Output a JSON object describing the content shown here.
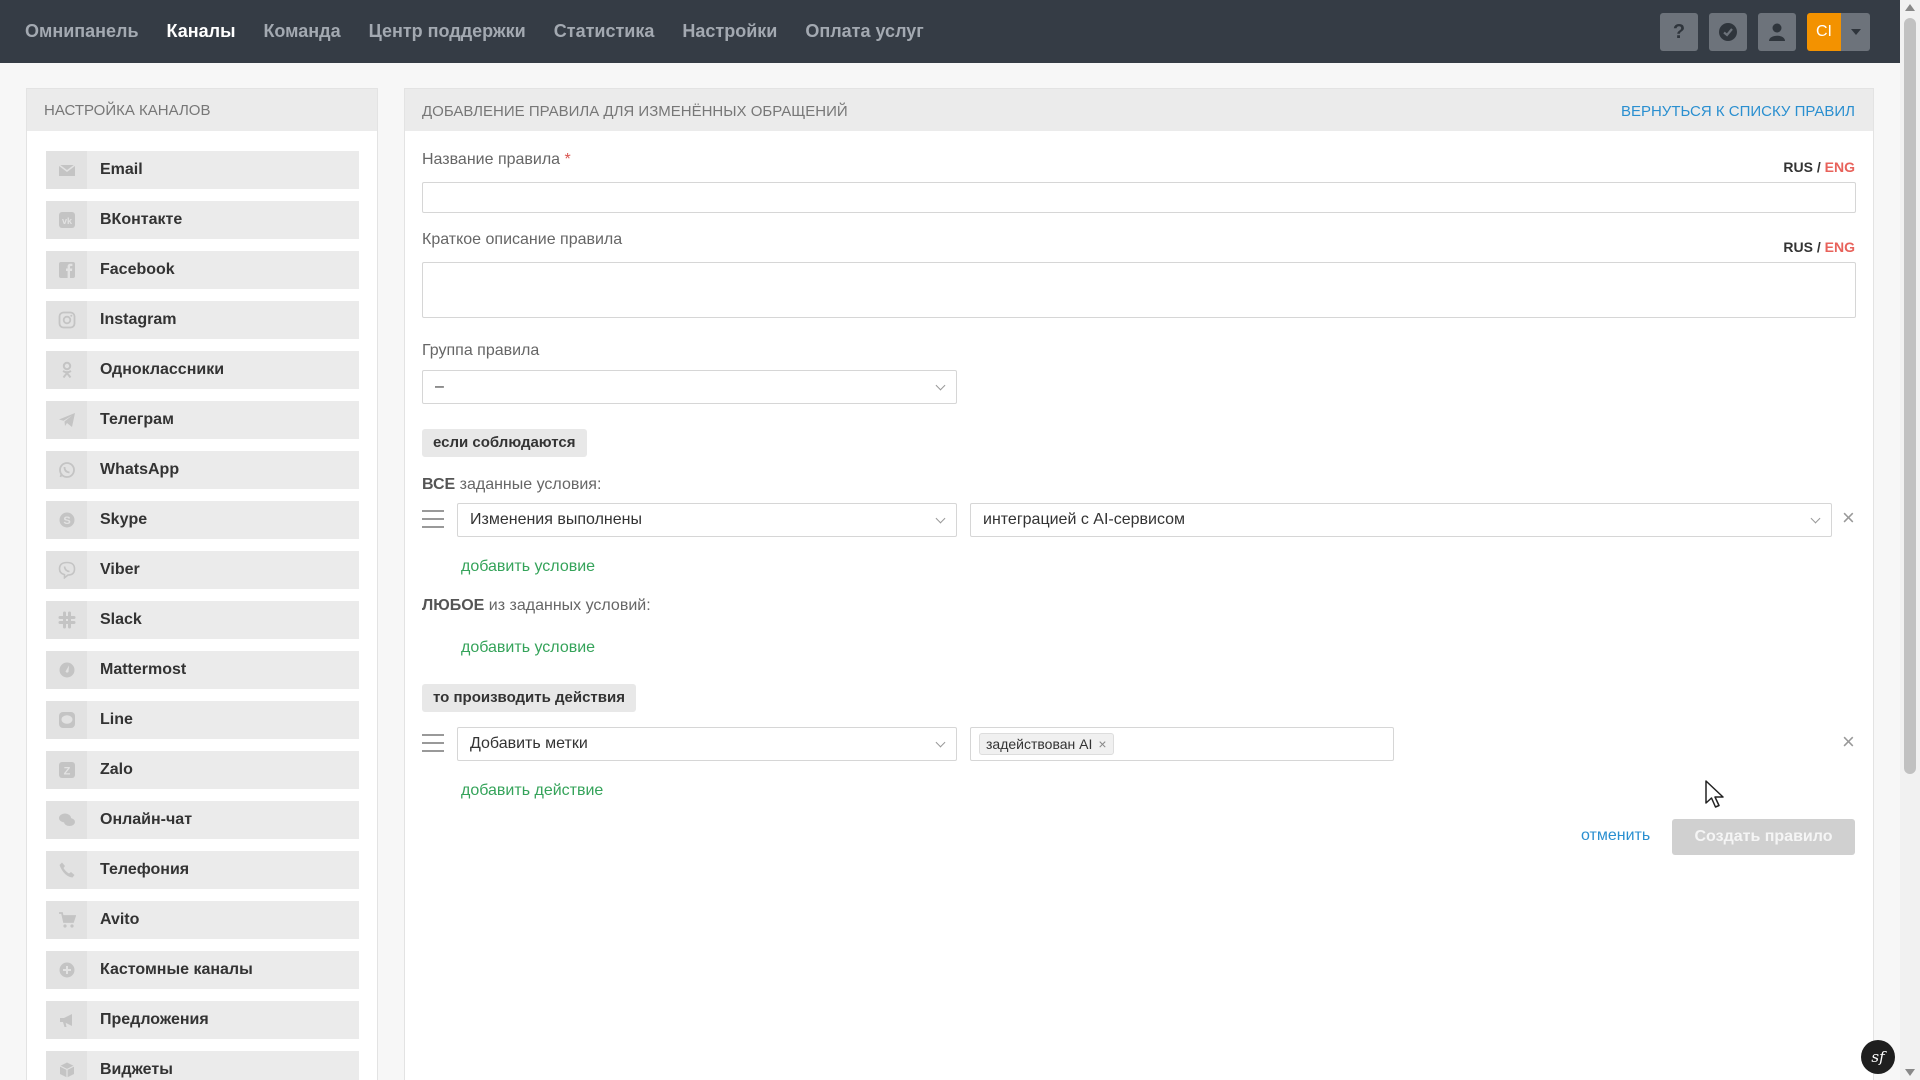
{
  "nav": {
    "items": [
      {
        "label": "Омнипанель",
        "active": false
      },
      {
        "label": "Каналы",
        "active": true
      },
      {
        "label": "Команда",
        "active": false
      },
      {
        "label": "Центр поддержки",
        "active": false
      },
      {
        "label": "Статистика",
        "active": false
      },
      {
        "label": "Настройки",
        "active": false
      },
      {
        "label": "Оплата услуг",
        "active": false
      }
    ],
    "help_label": "?",
    "user_initials": "CI",
    "accent_color": "#f39200"
  },
  "sidebar": {
    "title": "НАСТРОЙКА КАНАЛОВ",
    "channels": [
      {
        "label": "Email",
        "icon": "email-icon"
      },
      {
        "label": "ВКонтакте",
        "icon": "vk-icon"
      },
      {
        "label": "Facebook",
        "icon": "facebook-icon"
      },
      {
        "label": "Instagram",
        "icon": "instagram-icon"
      },
      {
        "label": "Одноклассники",
        "icon": "odnoklassniki-icon"
      },
      {
        "label": "Телеграм",
        "icon": "telegram-icon"
      },
      {
        "label": "WhatsApp",
        "icon": "whatsapp-icon"
      },
      {
        "label": "Skype",
        "icon": "skype-icon"
      },
      {
        "label": "Viber",
        "icon": "viber-icon"
      },
      {
        "label": "Slack",
        "icon": "slack-icon"
      },
      {
        "label": "Mattermost",
        "icon": "mattermost-icon"
      },
      {
        "label": "Line",
        "icon": "line-icon"
      },
      {
        "label": "Zalo",
        "icon": "zalo-icon"
      },
      {
        "label": "Онлайн-чат",
        "icon": "chat-icon"
      },
      {
        "label": "Телефония",
        "icon": "phone-icon"
      },
      {
        "label": "Avito",
        "icon": "cart-icon"
      },
      {
        "label": "Кастомные каналы",
        "icon": "plus-circle-icon"
      },
      {
        "label": "Предложения",
        "icon": "megaphone-icon"
      },
      {
        "label": "Виджеты",
        "icon": "box-icon"
      }
    ]
  },
  "main": {
    "title": "ДОБАВЛЕНИЕ ПРАВИЛА ДЛЯ ИЗМЕНЁННЫХ ОБРАЩЕНИЙ",
    "back_link": "ВЕРНУТЬСЯ К СПИСКУ ПРАВИЛ",
    "lang": {
      "rus": "RUS",
      "sep": "/",
      "eng": "ENG"
    },
    "rule_name": {
      "label": "Название правила",
      "required_mark": "*",
      "value": ""
    },
    "rule_desc": {
      "label": "Краткое описание правила",
      "value": ""
    },
    "rule_group": {
      "label": "Группа правила",
      "value": "–"
    },
    "if_pill": "если соблюдаются",
    "all_conditions": {
      "strong": "ВСЕ",
      "rest": " заданные условия:"
    },
    "condition": {
      "field": "Изменения выполнены",
      "value": "интеграцией с AI-сервисом",
      "remove": "×"
    },
    "add_condition": "добавить условие",
    "any_conditions": {
      "strong": "ЛЮБОЕ",
      "rest": " из заданных условий:"
    },
    "add_condition_any": "добавить условие",
    "then_pill": "то производить действия",
    "action": {
      "field": "Добавить метки",
      "tag": "задействован AI",
      "tag_remove": "×",
      "remove": "×"
    },
    "add_action": "добавить действие",
    "cancel": "отменить",
    "create": "Создать правило"
  },
  "badge": {
    "label": "sf"
  }
}
